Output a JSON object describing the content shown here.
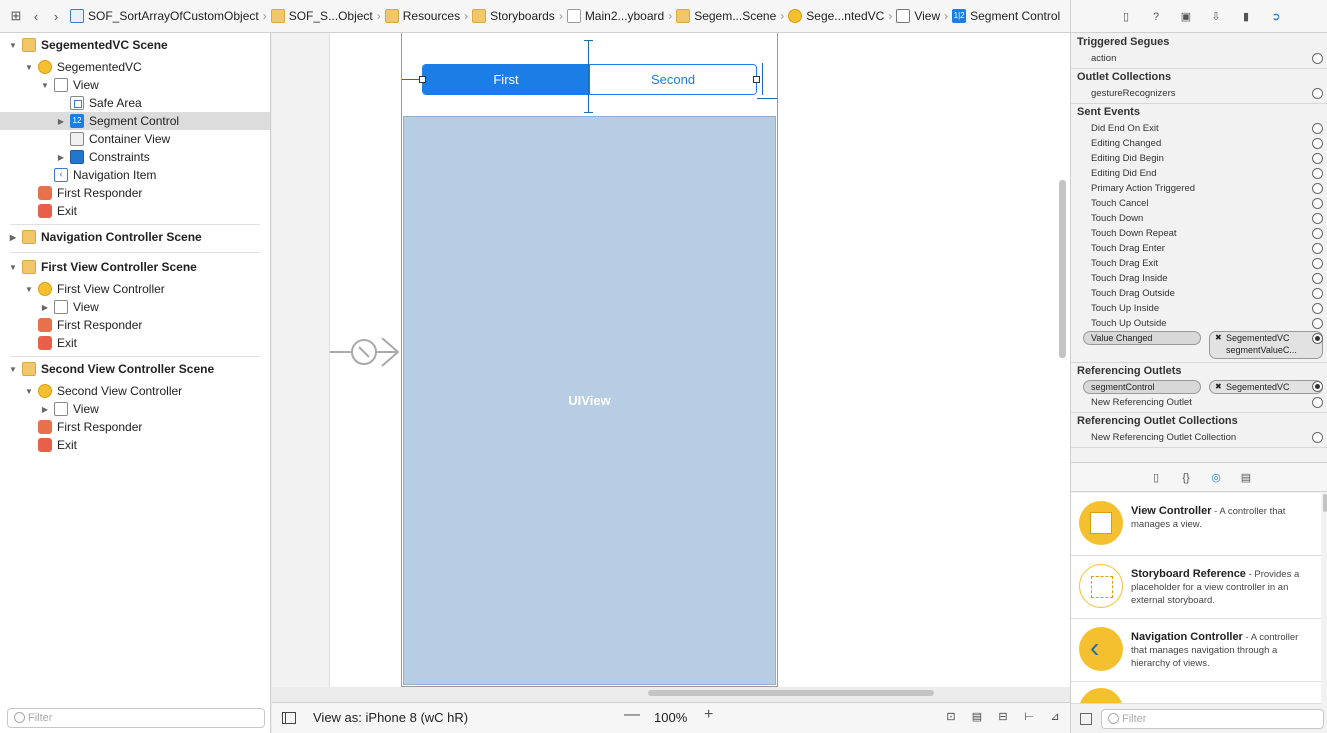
{
  "breadcrumbs": [
    "SOF_SortArrayOfCustomObject",
    "SOF_S...Object",
    "Resources",
    "Storyboards",
    "Main2...yboard",
    "Segem...Scene",
    "Sege...ntedVC",
    "View",
    "Segment Control"
  ],
  "outline": {
    "scene1": "SegementedVC Scene",
    "vc1": "SegementedVC",
    "view1": "View",
    "safe_area": "Safe Area",
    "segment_control": "Segment Control",
    "container_view": "Container View",
    "constraints": "Constraints",
    "nav_item": "Navigation Item",
    "first_responder": "First Responder",
    "exit": "Exit",
    "scene2": "Navigation Controller Scene",
    "scene3": "First View Controller Scene",
    "vc3": "First View Controller",
    "scene4": "Second View Controller Scene",
    "vc4": "Second View Controller",
    "filter_placeholder": "Filter"
  },
  "canvas": {
    "seg_first": "First",
    "seg_second": "Second",
    "uiview_label": "UIView"
  },
  "bottombar": {
    "view_as": "View as: iPhone 8 (wC hR)",
    "zoom": "100%",
    "zoom_out": "—",
    "zoom_in": "+"
  },
  "inspector": {
    "triggered_segues": "Triggered Segues",
    "action": "action",
    "outlet_collections": "Outlet Collections",
    "gesture_recognizers": "gestureRecognizers",
    "sent_events": "Sent Events",
    "events": [
      "Did End On Exit",
      "Editing Changed",
      "Editing Did Begin",
      "Editing Did End",
      "Primary Action Triggered",
      "Touch Cancel",
      "Touch Down",
      "Touch Down Repeat",
      "Touch Drag Enter",
      "Touch Drag Exit",
      "Touch Drag Inside",
      "Touch Drag Outside",
      "Touch Up Inside",
      "Touch Up Outside"
    ],
    "value_changed": "Value Changed",
    "value_changed_target": "SegementedVC",
    "value_changed_action": "segmentValueC...",
    "referencing_outlets": "Referencing Outlets",
    "segment_outlet": "segmentControl",
    "segment_outlet_target": "SegementedVC",
    "new_ref_outlet": "New Referencing Outlet",
    "ref_outlet_collections": "Referencing Outlet Collections",
    "new_ref_outlet_collection": "New Referencing Outlet Collection"
  },
  "library": [
    {
      "title": "View Controller",
      "desc": " - A controller that manages a view."
    },
    {
      "title": "Storyboard Reference",
      "desc": " - Provides a placeholder for a view controller in an external storyboard."
    },
    {
      "title": "Navigation Controller",
      "desc": " - A controller that manages navigation through a hierarchy of views."
    }
  ],
  "library_filter_placeholder": "Filter"
}
